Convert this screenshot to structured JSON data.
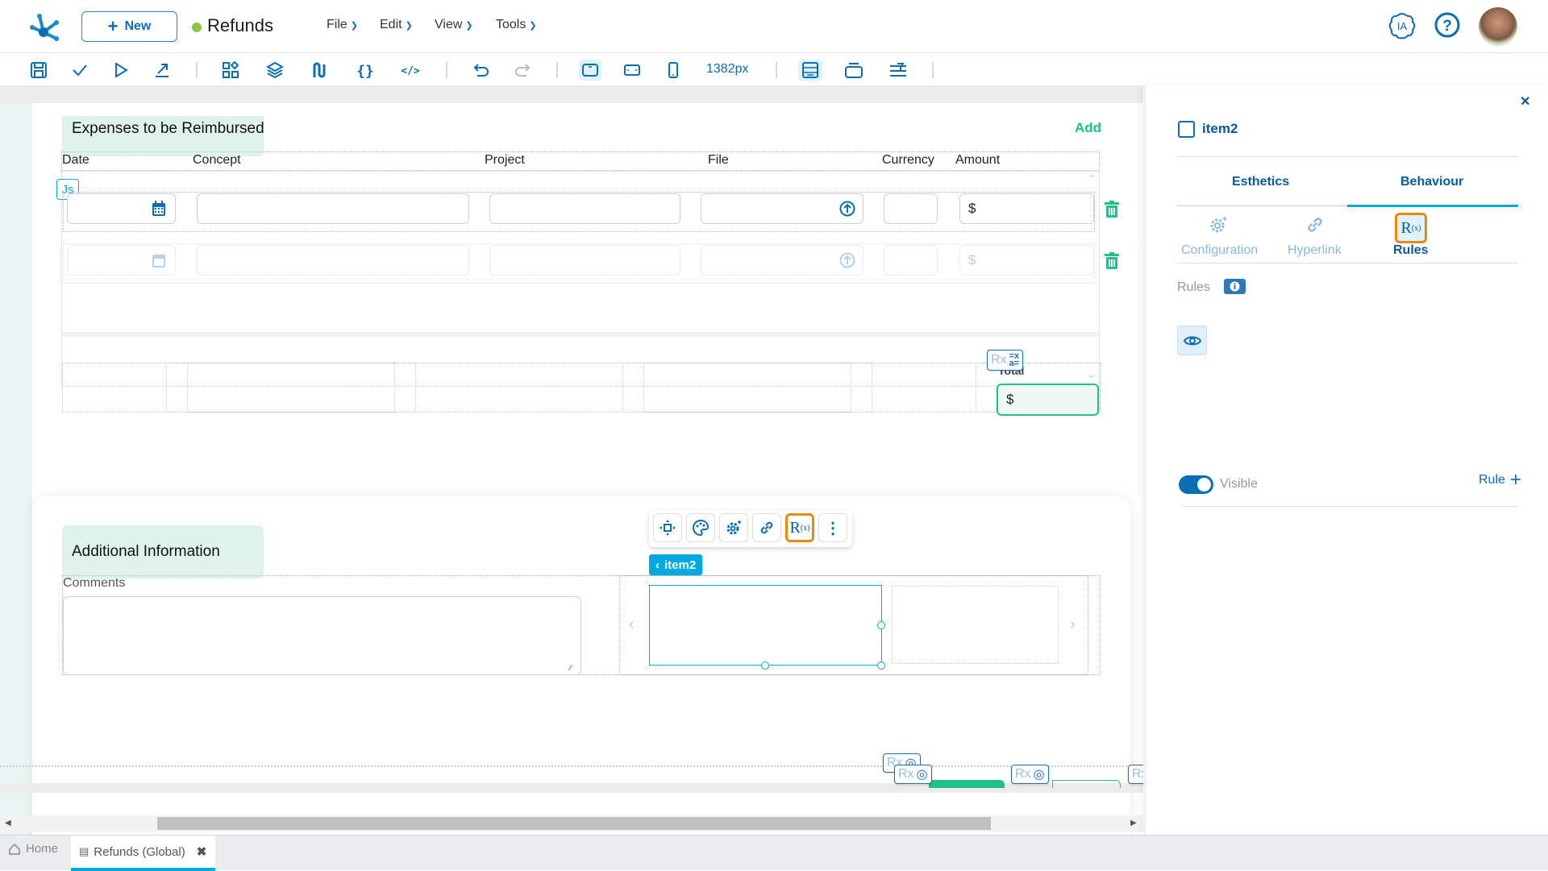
{
  "header": {
    "new_button": "New",
    "app_title": "Refunds",
    "status_color": "#8cc63f",
    "menus": [
      "File",
      "Edit",
      "View",
      "Tools"
    ],
    "ia_label": "IA"
  },
  "toolbar": {
    "icons": [
      "save-icon",
      "check-icon",
      "play-icon",
      "export-icon",
      "components-icon",
      "layers-icon",
      "flow-icon",
      "braces-icon",
      "code-icon",
      "undo-icon",
      "redo-icon",
      "desktop-view-icon",
      "tablet-view-icon",
      "mobile-view-icon",
      "layout-icon",
      "frame-icon",
      "align-icon"
    ],
    "width_readout": "1382px"
  },
  "expenses": {
    "title": "Expenses to be Reimbursed",
    "add_label": "Add",
    "js_badge": "Js",
    "columns": [
      "Date",
      "Concept",
      "Project",
      "File",
      "Currency",
      "Amount"
    ],
    "rows": [
      {
        "date": "",
        "concept": "",
        "project": "",
        "file": "",
        "currency": "",
        "amount": "$"
      },
      {
        "date": "",
        "concept": "",
        "project": "",
        "file": "",
        "currency": "",
        "amount": "$"
      }
    ]
  },
  "totals": {
    "label": "Total",
    "value": "$",
    "rx_chip": "Rx"
  },
  "additional": {
    "title": "Additional Information",
    "comments_label": "Comments",
    "comments_value": ""
  },
  "selection": {
    "item_label": "item2",
    "toolbar_icons": [
      "move-icon",
      "palette-icon",
      "settings-icon",
      "link-icon",
      "rules-icon",
      "more-icon"
    ]
  },
  "bottom_chips": [
    "Rx",
    "Rx",
    "Rx",
    "Rx"
  ],
  "panel": {
    "item_name": "item2",
    "tabs": [
      "Esthetics",
      "Behaviour"
    ],
    "active_tab": "Behaviour",
    "subtabs": [
      "Configuration",
      "Hyperlink",
      "Rules"
    ],
    "active_subtab": "Rules",
    "rules_label": "Rules",
    "visible_label": "Visible",
    "visible_on": true,
    "rule_button": "Rule"
  },
  "tabs_bottom": [
    {
      "label": "Home",
      "active": false
    },
    {
      "label": "Refunds (Global)",
      "active": true
    }
  ],
  "colors": {
    "brand_blue": "#0a6db8",
    "accent_cyan": "#00a9e0",
    "green": "#22c08a",
    "highlight_orange": "#e88a0c"
  }
}
